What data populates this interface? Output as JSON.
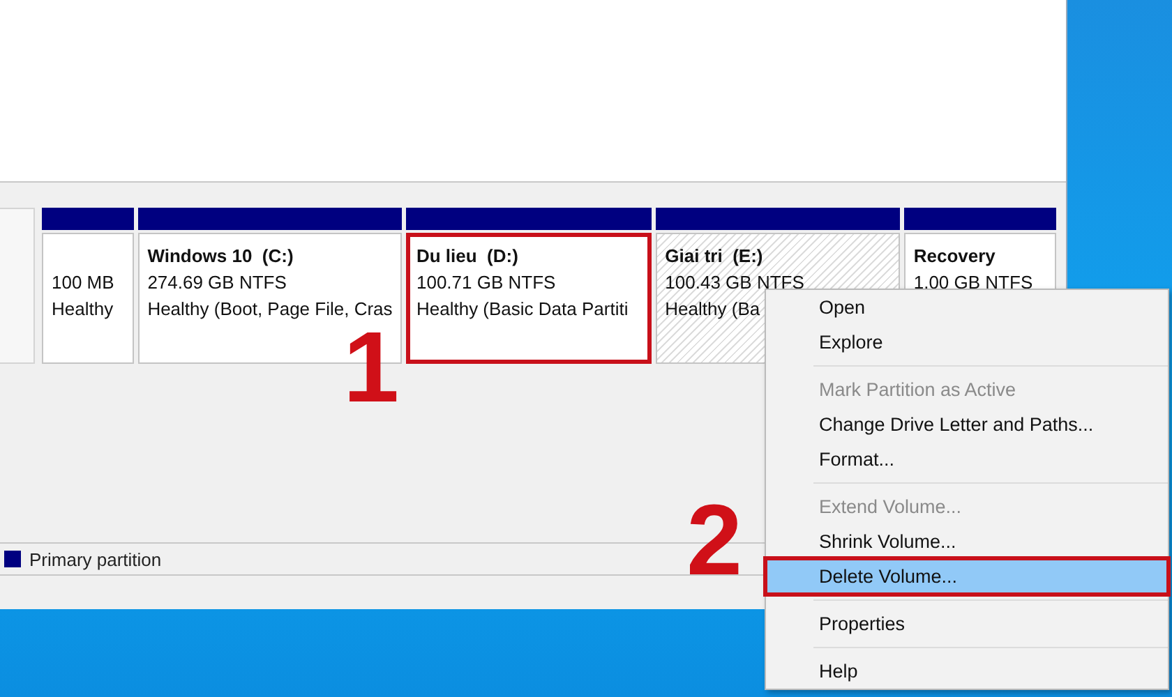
{
  "partitions": [
    {
      "size": "100 MB",
      "status": "Healthy",
      "selected": false,
      "annotated": false
    },
    {
      "name": "Windows 10  (C:)",
      "size": "274.69 GB NTFS",
      "status": "Healthy (Boot, Page File, Cras",
      "selected": false,
      "annotated": false
    },
    {
      "name": "Du lieu  (D:)",
      "size": "100.71 GB NTFS",
      "status": "Healthy (Basic Data Partiti",
      "selected": false,
      "annotated": true
    },
    {
      "name": "Giai tri  (E:)",
      "size": "100.43 GB NTFS",
      "status": "Healthy (Ba",
      "selected": true,
      "annotated": false
    },
    {
      "name": "Recovery",
      "size": "1.00 GB NTFS",
      "selected": false,
      "annotated": false
    }
  ],
  "legend": [
    {
      "label": "Primary partition",
      "color": "#000080"
    }
  ],
  "context_menu": {
    "items": [
      {
        "kind": "item",
        "label": "Open",
        "disabled": false,
        "selected": false,
        "annotated": false
      },
      {
        "kind": "item",
        "label": "Explore",
        "disabled": false,
        "selected": false,
        "annotated": false
      },
      {
        "kind": "separator"
      },
      {
        "kind": "item",
        "label": "Mark Partition as Active",
        "disabled": true,
        "selected": false,
        "annotated": false
      },
      {
        "kind": "item",
        "label": "Change Drive Letter and Paths...",
        "disabled": false,
        "selected": false,
        "annotated": false
      },
      {
        "kind": "item",
        "label": "Format...",
        "disabled": false,
        "selected": false,
        "annotated": false
      },
      {
        "kind": "separator"
      },
      {
        "kind": "item",
        "label": "Extend Volume...",
        "disabled": true,
        "selected": false,
        "annotated": false
      },
      {
        "kind": "item",
        "label": "Shrink Volume...",
        "disabled": false,
        "selected": false,
        "annotated": false
      },
      {
        "kind": "item",
        "label": "Delete Volume...",
        "disabled": false,
        "selected": true,
        "annotated": true
      },
      {
        "kind": "separator"
      },
      {
        "kind": "item",
        "label": "Properties",
        "disabled": false,
        "selected": false,
        "annotated": false
      },
      {
        "kind": "separator"
      },
      {
        "kind": "item",
        "label": "Help",
        "disabled": false,
        "selected": false,
        "annotated": false
      }
    ]
  },
  "step_numbers": [
    {
      "label": "1"
    },
    {
      "label": "2"
    }
  ]
}
